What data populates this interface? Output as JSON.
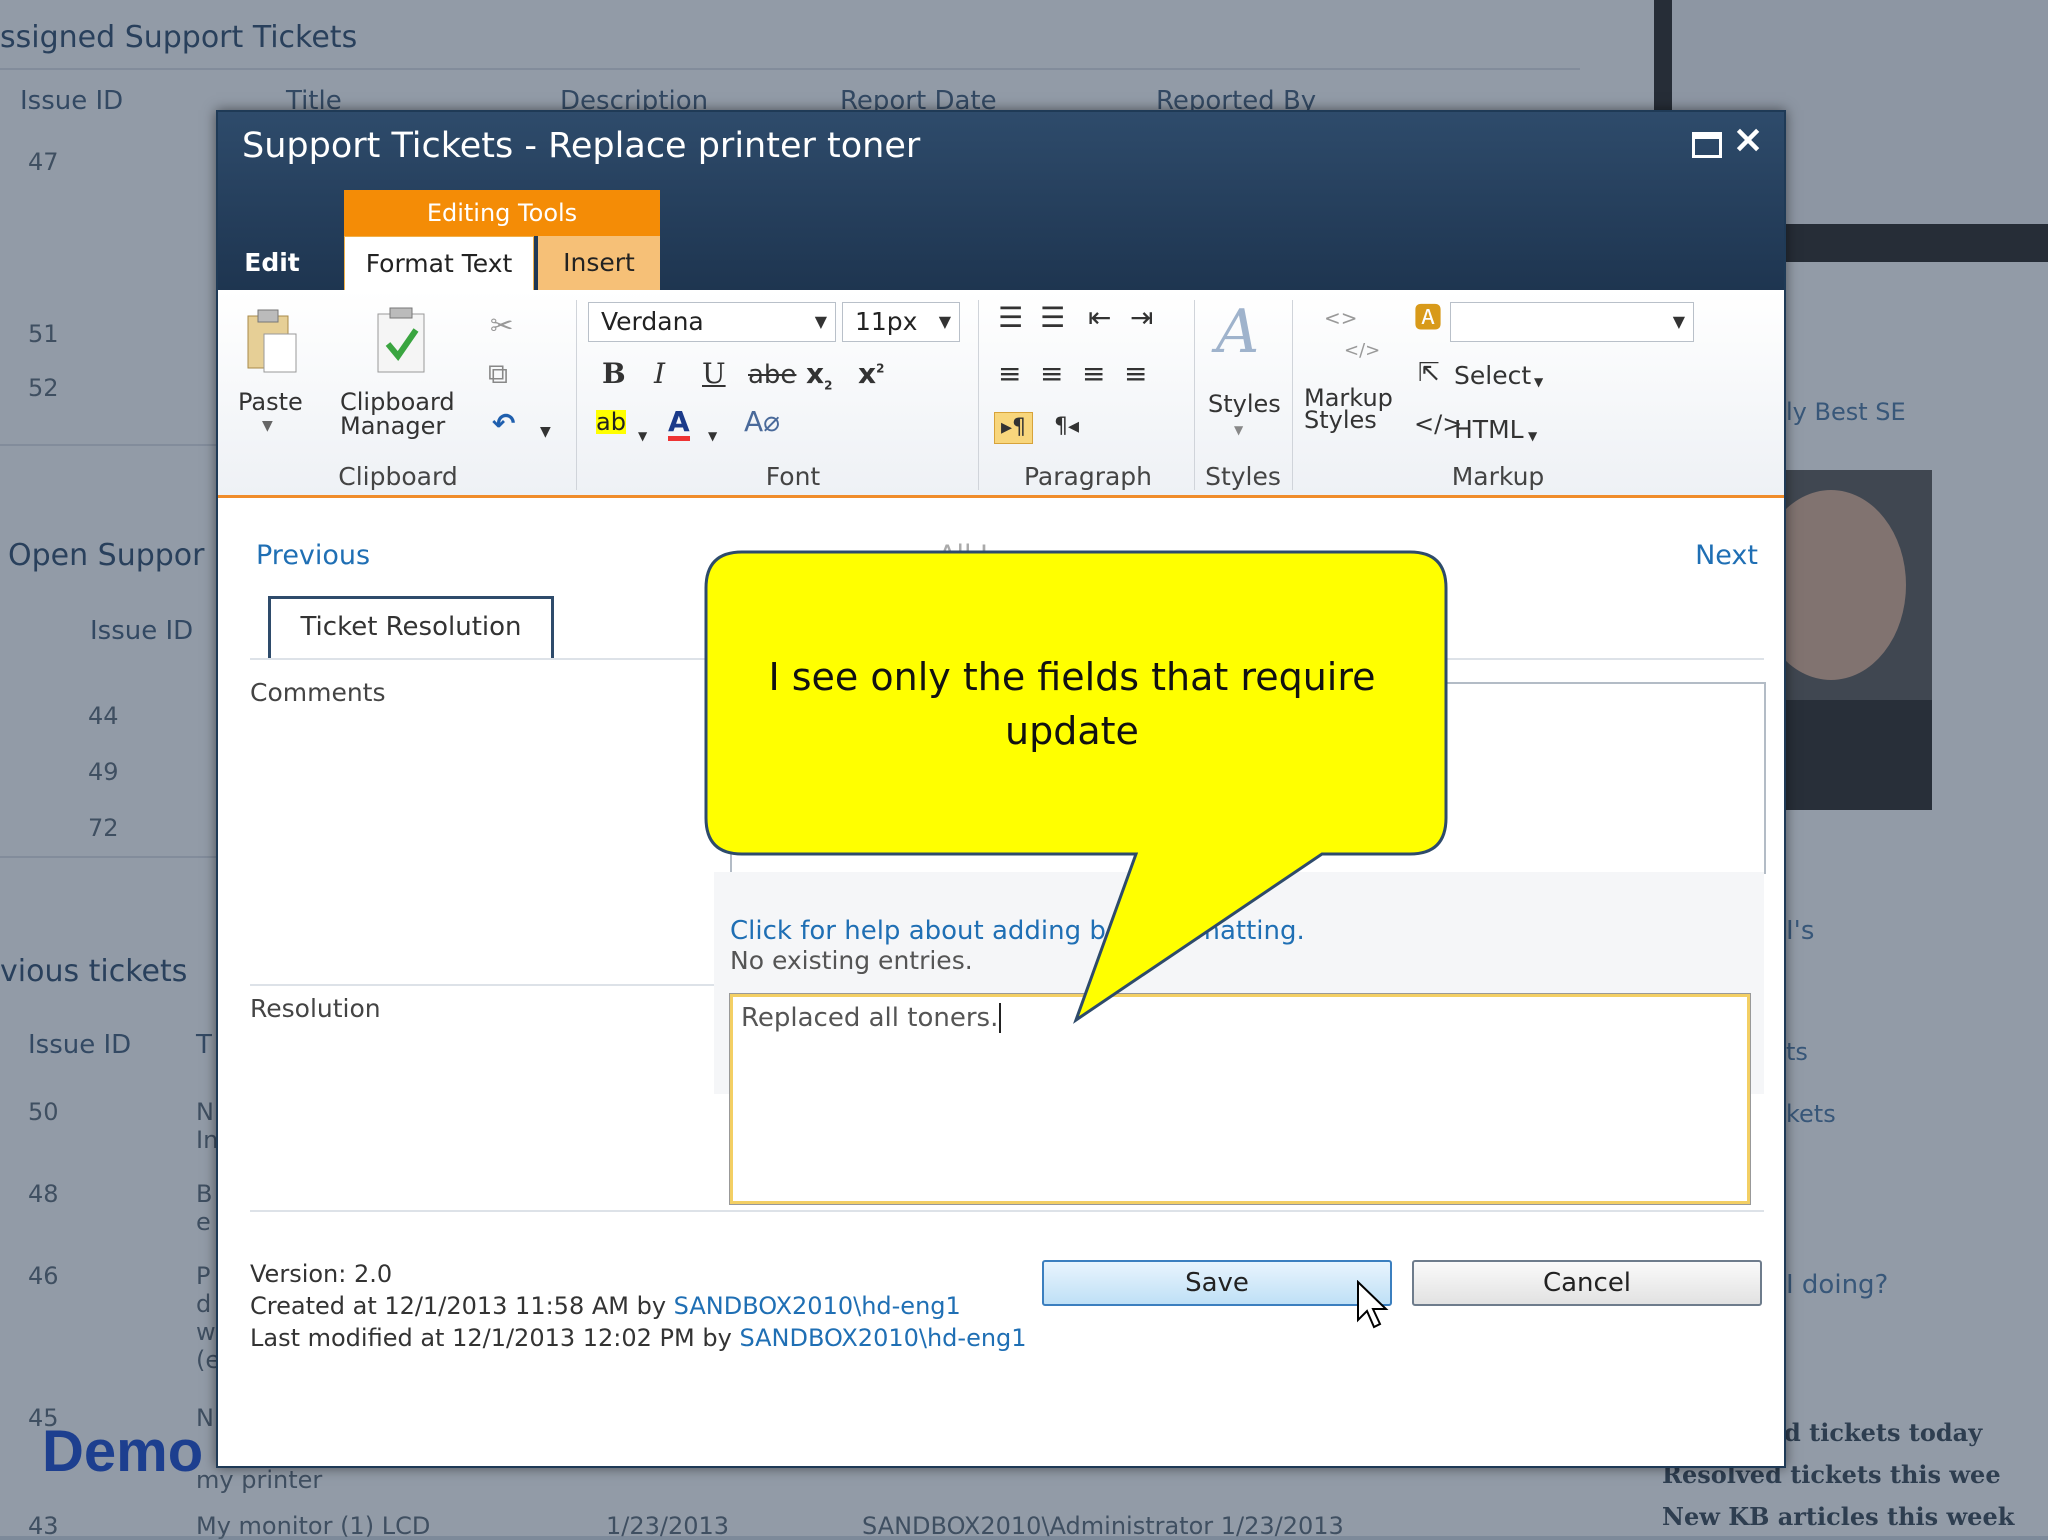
{
  "background": {
    "assigned_title": "ssigned Support Tickets",
    "assigned_headers": [
      "Issue ID",
      "Title",
      "Description",
      "Report Date",
      "Reported By"
    ],
    "assigned_ids": [
      "47",
      "51",
      "52"
    ],
    "open_title": "Open Suppor",
    "open_header": "Issue ID",
    "open_ids": [
      "44",
      "49",
      "72"
    ],
    "prev_title": "vious tickets",
    "prev_headers": [
      "Issue ID",
      "T"
    ],
    "prev_ids": [
      "50",
      "48",
      "46",
      "45",
      "43"
    ],
    "prev_frag": [
      "N",
      "In",
      "B",
      "e",
      "P",
      "d",
      "w",
      "(e",
      "N"
    ],
    "printer_text": "my printer",
    "bottom_row": [
      "My monitor (1) LCD",
      "1/23/2013",
      "SANDBOX2010\\Administrator  1/23/2013"
    ],
    "right_texts": [
      "ly Best SE",
      "I's",
      "ts",
      "kets",
      "I doing?"
    ],
    "stats": [
      "d tickets today",
      "Resolved tickets this wee",
      "New KB articles this week"
    ]
  },
  "dialog": {
    "title": "Support Tickets - Replace printer toner",
    "editing_tools": "Editing Tools",
    "tabs": {
      "edit": "Edit",
      "format": "Format Text",
      "insert": "Insert"
    },
    "ribbon": {
      "paste": "Paste",
      "clipboard_manager_1": "Clipboard",
      "clipboard_manager_2": "Manager",
      "font_name": "Verdana",
      "font_size": "11px",
      "styles": "Styles",
      "markup_styles_1": "Markup",
      "markup_styles_2": "Styles",
      "select": "Select",
      "html": "HTML",
      "groups": {
        "clipboard": "Clipboard",
        "font": "Font",
        "paragraph": "Paragraph",
        "styles": "Styles",
        "markup": "Markup"
      }
    },
    "nav": {
      "previous": "Previous",
      "next": "Next",
      "all": "All I..."
    },
    "ticket_tab": "Ticket Resolution",
    "comments_label": "Comments",
    "help_link": "Click for help about adding b       ML formatting.",
    "no_entries": "No existing entries.",
    "resolution_label": "Resolution",
    "resolution_value": "Replaced all toners.",
    "meta": {
      "version": "Version: 2.0",
      "created_prefix": "Created at 12/1/2013 11:58 AM by ",
      "created_user": "SANDBOX2010\\hd-eng1",
      "modified_prefix": "Last modified at 12/1/2013 12:02 PM by ",
      "modified_user": "SANDBOX2010\\hd-eng1"
    },
    "save": "Save",
    "cancel": "Cancel"
  },
  "callout_text": "I see only the fields that require update",
  "demo_label": "Demo",
  "colors": {
    "callout_fill": "#ffff00",
    "ribbon_accent": "#f48c06",
    "titlebar": "#1e3550",
    "link": "#1f6fb4"
  }
}
